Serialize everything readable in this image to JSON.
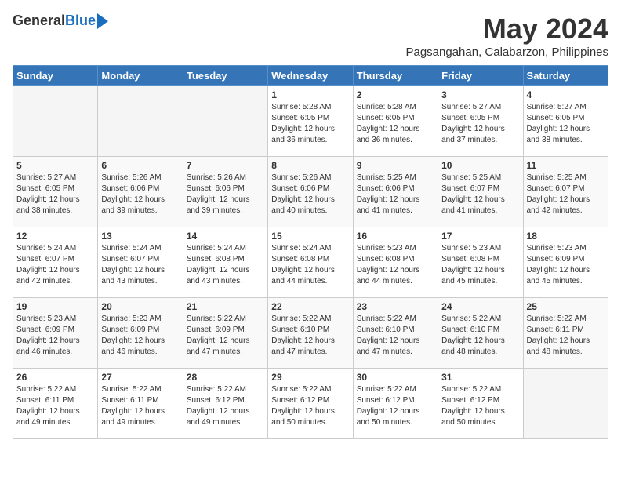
{
  "header": {
    "logo_general": "General",
    "logo_blue": "Blue",
    "month_title": "May 2024",
    "location": "Pagsangahan, Calabarzon, Philippines"
  },
  "days_of_week": [
    "Sunday",
    "Monday",
    "Tuesday",
    "Wednesday",
    "Thursday",
    "Friday",
    "Saturday"
  ],
  "weeks": [
    [
      {
        "day": "",
        "sunrise": "",
        "sunset": "",
        "daylight": ""
      },
      {
        "day": "",
        "sunrise": "",
        "sunset": "",
        "daylight": ""
      },
      {
        "day": "",
        "sunrise": "",
        "sunset": "",
        "daylight": ""
      },
      {
        "day": "1",
        "sunrise": "5:28 AM",
        "sunset": "6:05 PM",
        "daylight": "12 hours and 36 minutes."
      },
      {
        "day": "2",
        "sunrise": "5:28 AM",
        "sunset": "6:05 PM",
        "daylight": "12 hours and 36 minutes."
      },
      {
        "day": "3",
        "sunrise": "5:27 AM",
        "sunset": "6:05 PM",
        "daylight": "12 hours and 37 minutes."
      },
      {
        "day": "4",
        "sunrise": "5:27 AM",
        "sunset": "6:05 PM",
        "daylight": "12 hours and 38 minutes."
      }
    ],
    [
      {
        "day": "5",
        "sunrise": "5:27 AM",
        "sunset": "6:05 PM",
        "daylight": "12 hours and 38 minutes."
      },
      {
        "day": "6",
        "sunrise": "5:26 AM",
        "sunset": "6:06 PM",
        "daylight": "12 hours and 39 minutes."
      },
      {
        "day": "7",
        "sunrise": "5:26 AM",
        "sunset": "6:06 PM",
        "daylight": "12 hours and 39 minutes."
      },
      {
        "day": "8",
        "sunrise": "5:26 AM",
        "sunset": "6:06 PM",
        "daylight": "12 hours and 40 minutes."
      },
      {
        "day": "9",
        "sunrise": "5:25 AM",
        "sunset": "6:06 PM",
        "daylight": "12 hours and 41 minutes."
      },
      {
        "day": "10",
        "sunrise": "5:25 AM",
        "sunset": "6:07 PM",
        "daylight": "12 hours and 41 minutes."
      },
      {
        "day": "11",
        "sunrise": "5:25 AM",
        "sunset": "6:07 PM",
        "daylight": "12 hours and 42 minutes."
      }
    ],
    [
      {
        "day": "12",
        "sunrise": "5:24 AM",
        "sunset": "6:07 PM",
        "daylight": "12 hours and 42 minutes."
      },
      {
        "day": "13",
        "sunrise": "5:24 AM",
        "sunset": "6:07 PM",
        "daylight": "12 hours and 43 minutes."
      },
      {
        "day": "14",
        "sunrise": "5:24 AM",
        "sunset": "6:08 PM",
        "daylight": "12 hours and 43 minutes."
      },
      {
        "day": "15",
        "sunrise": "5:24 AM",
        "sunset": "6:08 PM",
        "daylight": "12 hours and 44 minutes."
      },
      {
        "day": "16",
        "sunrise": "5:23 AM",
        "sunset": "6:08 PM",
        "daylight": "12 hours and 44 minutes."
      },
      {
        "day": "17",
        "sunrise": "5:23 AM",
        "sunset": "6:08 PM",
        "daylight": "12 hours and 45 minutes."
      },
      {
        "day": "18",
        "sunrise": "5:23 AM",
        "sunset": "6:09 PM",
        "daylight": "12 hours and 45 minutes."
      }
    ],
    [
      {
        "day": "19",
        "sunrise": "5:23 AM",
        "sunset": "6:09 PM",
        "daylight": "12 hours and 46 minutes."
      },
      {
        "day": "20",
        "sunrise": "5:23 AM",
        "sunset": "6:09 PM",
        "daylight": "12 hours and 46 minutes."
      },
      {
        "day": "21",
        "sunrise": "5:22 AM",
        "sunset": "6:09 PM",
        "daylight": "12 hours and 47 minutes."
      },
      {
        "day": "22",
        "sunrise": "5:22 AM",
        "sunset": "6:10 PM",
        "daylight": "12 hours and 47 minutes."
      },
      {
        "day": "23",
        "sunrise": "5:22 AM",
        "sunset": "6:10 PM",
        "daylight": "12 hours and 47 minutes."
      },
      {
        "day": "24",
        "sunrise": "5:22 AM",
        "sunset": "6:10 PM",
        "daylight": "12 hours and 48 minutes."
      },
      {
        "day": "25",
        "sunrise": "5:22 AM",
        "sunset": "6:11 PM",
        "daylight": "12 hours and 48 minutes."
      }
    ],
    [
      {
        "day": "26",
        "sunrise": "5:22 AM",
        "sunset": "6:11 PM",
        "daylight": "12 hours and 49 minutes."
      },
      {
        "day": "27",
        "sunrise": "5:22 AM",
        "sunset": "6:11 PM",
        "daylight": "12 hours and 49 minutes."
      },
      {
        "day": "28",
        "sunrise": "5:22 AM",
        "sunset": "6:12 PM",
        "daylight": "12 hours and 49 minutes."
      },
      {
        "day": "29",
        "sunrise": "5:22 AM",
        "sunset": "6:12 PM",
        "daylight": "12 hours and 50 minutes."
      },
      {
        "day": "30",
        "sunrise": "5:22 AM",
        "sunset": "6:12 PM",
        "daylight": "12 hours and 50 minutes."
      },
      {
        "day": "31",
        "sunrise": "5:22 AM",
        "sunset": "6:12 PM",
        "daylight": "12 hours and 50 minutes."
      },
      {
        "day": "",
        "sunrise": "",
        "sunset": "",
        "daylight": ""
      }
    ]
  ]
}
